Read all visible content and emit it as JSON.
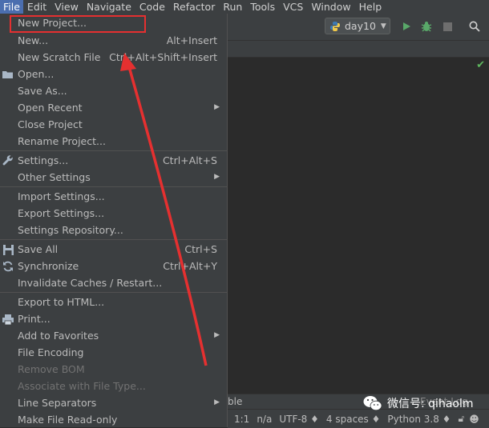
{
  "menubar": {
    "items": [
      "File",
      "Edit",
      "View",
      "Navigate",
      "Code",
      "Refactor",
      "Run",
      "Tools",
      "VCS",
      "Window",
      "Help"
    ]
  },
  "toolbar": {
    "run_config": "day10",
    "icons": [
      "run-icon",
      "debug-icon",
      "stop-icon",
      "search-icon"
    ]
  },
  "bottom_panel": {
    "text": "ble",
    "event_log": "Event Log"
  },
  "statusbar": {
    "position": "1:1",
    "na": "n/a",
    "encoding": "UTF-8 ♦",
    "indent": "4 spaces ♦",
    "interpreter": "Python 3.8 ♦"
  },
  "file_menu": {
    "new_project": "New Project...",
    "new": "New...",
    "new_shortcut": "Alt+Insert",
    "new_scratch": "New Scratch File",
    "new_scratch_shortcut": "Ctrl+Alt+Shift+Insert",
    "open": "Open...",
    "save_as": "Save As...",
    "open_recent": "Open Recent",
    "close_project": "Close Project",
    "rename_project": "Rename Project...",
    "settings": "Settings...",
    "settings_shortcut": "Ctrl+Alt+S",
    "other_settings": "Other Settings",
    "import_settings": "Import Settings...",
    "export_settings": "Export Settings...",
    "settings_repository": "Settings Repository...",
    "save_all": "Save All",
    "save_all_shortcut": "Ctrl+S",
    "synchronize": "Synchronize",
    "synchronize_shortcut": "Ctrl+Alt+Y",
    "invalidate_caches": "Invalidate Caches / Restart...",
    "export_html": "Export to HTML...",
    "print": "Print...",
    "add_favorites": "Add to Favorites",
    "file_encoding": "File Encoding",
    "remove_bom": "Remove BOM",
    "associate": "Associate with File Type...",
    "line_separators": "Line Separators",
    "make_readonly": "Make File Read-only"
  },
  "watermark": {
    "text": "微信号: qihaolm"
  },
  "colors": {
    "menu_bg": "#3c3f41",
    "editor_bg": "#2b2b2b",
    "active_menu": "#4b6eaf",
    "annotation_red": "#e53030",
    "run_green": "#59a869"
  }
}
